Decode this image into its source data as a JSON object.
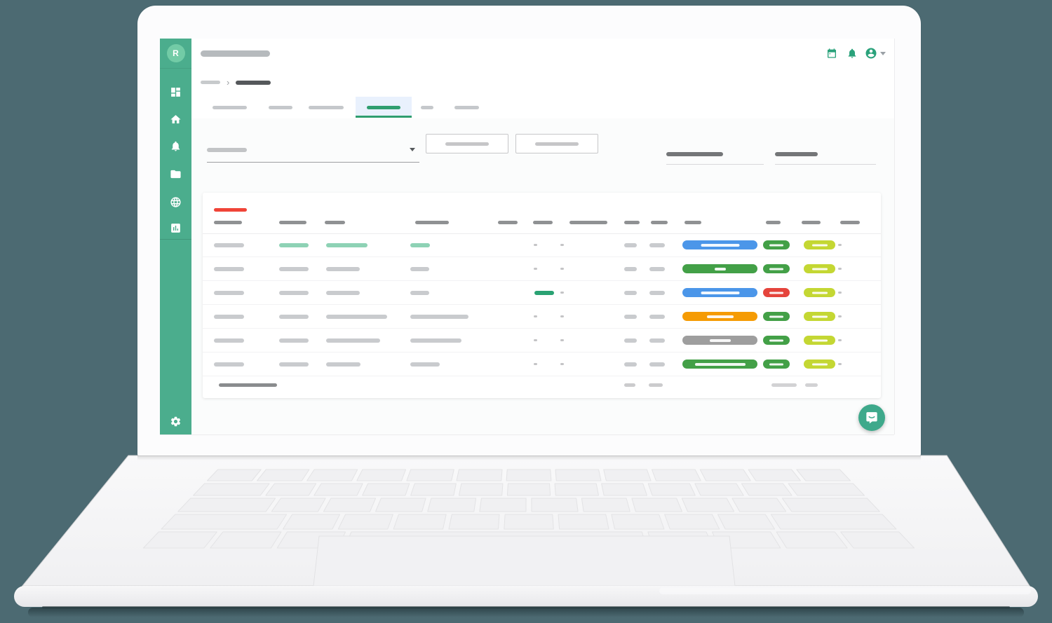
{
  "window": {
    "brand_letter": "R"
  },
  "colors": {
    "page_bg": "#4c6a72",
    "sidebar": "#4bad8d",
    "sidebar_avatar": "#72cba6",
    "icon_teal": "#2aa27b",
    "tab_active": "#2f9e6f",
    "tab_active_bg": "#e9f1fd",
    "card_accent_red": "#f04438",
    "status_blue": "#4b96e9",
    "status_green": "#43a047",
    "status_red": "#e5443c",
    "status_orange": "#f59b04",
    "status_gray": "#9e9e9e",
    "status_lime": "#c4d733",
    "row_highlight_green": "#8ed2b5",
    "mini_bar_green": "#2aa273",
    "chat_button": "#3ea98b"
  },
  "sidebar": {
    "icons": [
      "dashboard-icon",
      "home-icon",
      "notifications-icon",
      "folder-icon",
      "globe-icon",
      "chart-icon"
    ],
    "bottom_icon": "settings-icon"
  },
  "header": {
    "icons": [
      "calendar-icon",
      "bell-icon",
      "account-icon",
      "caret-down-icon"
    ]
  },
  "breadcrumb": {
    "levels": 2
  },
  "tabs": {
    "count": 6,
    "active_index": 3
  },
  "filters": {
    "selects": 1,
    "buttons": 2,
    "text_fields": 2
  },
  "table": {
    "header_column_count": 13,
    "rows": [
      {
        "tone": "highlight",
        "c3w": 59,
        "c4w": 28,
        "c5": "dot",
        "p1": "blue",
        "p1w": 55,
        "p2": "green"
      },
      {
        "tone": "normal",
        "c3w": 48,
        "c4w": 27,
        "c5": "dot",
        "p1": "green",
        "p1w": 16,
        "p2": "green"
      },
      {
        "tone": "normal",
        "c3w": 48,
        "c4w": 27,
        "c5": "bar",
        "p1": "blue",
        "p1w": 55,
        "p2": "red"
      },
      {
        "tone": "normal",
        "c3w": 87,
        "c4w": 83,
        "c5": "dot",
        "p1": "orange",
        "p1w": 38,
        "p2": "green"
      },
      {
        "tone": "normal",
        "c3w": 77,
        "c4w": 73,
        "c5": "dot",
        "p1": "gray",
        "p1w": 30,
        "p2": "green"
      },
      {
        "tone": "normal",
        "c3w": 49,
        "c4w": 42,
        "c5": "dot",
        "p1": "green",
        "p1w": 72,
        "p2": "green"
      }
    ],
    "footer": {
      "left_bars": 1,
      "middle_bars": 2,
      "right_bars": 2
    }
  },
  "chat": {
    "icon": "messenger-icon"
  }
}
